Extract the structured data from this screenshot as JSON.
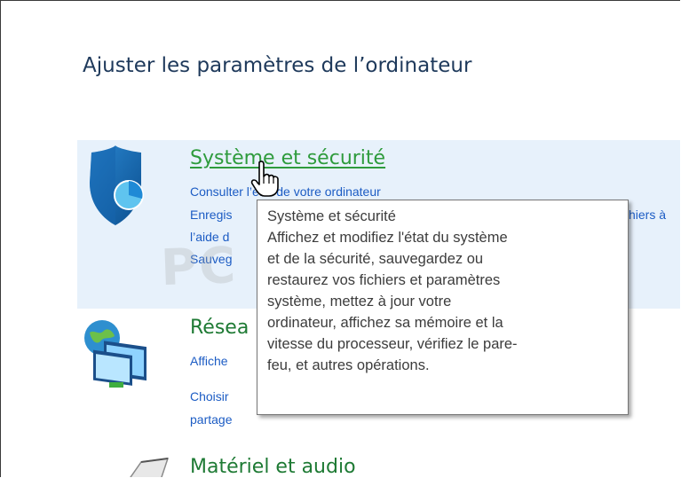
{
  "page": {
    "title": "Ajuster les paramètres de l’ordinateur"
  },
  "categories": [
    {
      "name": "system-security",
      "title": "Système et sécurité",
      "icon": "shield-icon",
      "links": [
        "Consulter l’état de votre ordinateur",
        "Enregis",
        "l’aide d",
        "Sauveg"
      ],
      "link_line1_right_fragment": "hiers à"
    },
    {
      "name": "network-internet",
      "title": "Résea",
      "icon": "network-icon",
      "links": [
        "Affiche",
        "Choisir",
        "partage"
      ]
    },
    {
      "name": "hardware-sound",
      "title": "Matériel et audio",
      "icon": "printer-icon"
    }
  ],
  "tooltip": {
    "lines": [
      "Système et sécurité",
      "Affichez et modifiez l'état du système",
      "et de la sécurité, sauvegardez ou",
      "restaurez vos fichiers et paramètres",
      "système, mettez à jour votre",
      "ordinateur, affichez sa mémoire et la",
      "vitesse du processeur, vérifiez le pare-",
      "feu, et autres opérations."
    ]
  },
  "watermark": "PC ASTUCES",
  "colors": {
    "heading": "#1e395b",
    "category_green": "#1e7a34",
    "category_hover_green": "#2e9b3c",
    "link_blue": "#1c5cc4",
    "hover_background": "#e7f1fb"
  }
}
